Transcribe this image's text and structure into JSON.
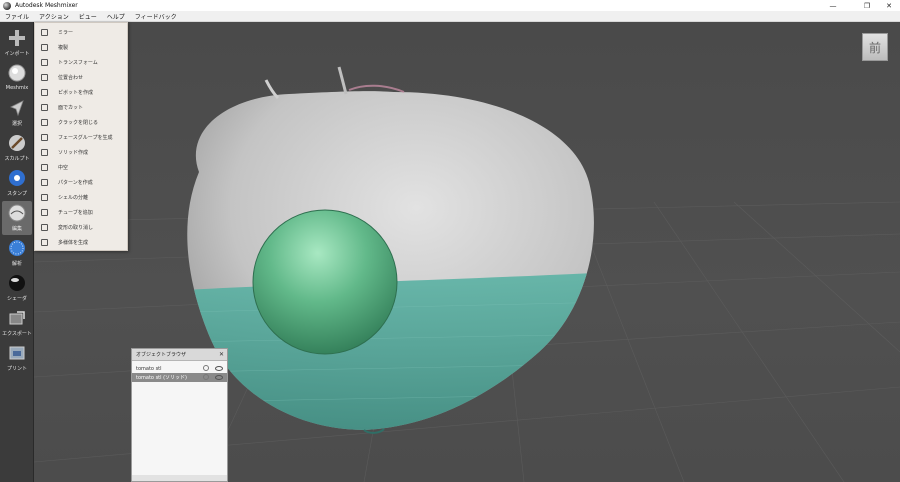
{
  "window": {
    "title": "Autodesk Meshmixer",
    "controls": {
      "minimize": "—",
      "maximize": "❐",
      "close": "✕"
    }
  },
  "menubar": {
    "items": [
      "ファイル",
      "アクション",
      "ビュー",
      "ヘルプ",
      "フィードバック"
    ]
  },
  "toolbar": {
    "items": [
      {
        "label": "インポート",
        "icon": "plus-icon"
      },
      {
        "label": "Meshmix",
        "icon": "meshmix-icon"
      },
      {
        "label": "選択",
        "icon": "select-arrow-icon"
      },
      {
        "label": "スカルプト",
        "icon": "brush-icon"
      },
      {
        "label": "スタンプ",
        "icon": "stamp-icon"
      },
      {
        "label": "編集",
        "icon": "edit-sphere-icon"
      },
      {
        "label": "解析",
        "icon": "analysis-icon"
      },
      {
        "label": "シェーダ",
        "icon": "shader-icon"
      },
      {
        "label": "エクスポート",
        "icon": "export-icon"
      },
      {
        "label": "プリント",
        "icon": "print-icon"
      }
    ]
  },
  "edit_menu": {
    "items": [
      {
        "label": "ミラー",
        "icon": "mirror-icon"
      },
      {
        "label": "複製",
        "icon": "duplicate-icon"
      },
      {
        "label": "トランスフォーム",
        "icon": "transform-icon"
      },
      {
        "label": "位置合わせ",
        "icon": "align-icon"
      },
      {
        "label": "ピボットを作成",
        "icon": "pivot-icon"
      },
      {
        "label": "面でカット",
        "icon": "plane-cut-icon"
      },
      {
        "label": "クラックを閉じる",
        "icon": "close-cracks-icon"
      },
      {
        "label": "フェースグループを生成",
        "icon": "facegroups-icon"
      },
      {
        "label": "ソリッド作成",
        "icon": "make-solid-icon"
      },
      {
        "label": "中空",
        "icon": "hollow-icon"
      },
      {
        "label": "パターンを作成",
        "icon": "pattern-icon"
      },
      {
        "label": "シェルの分離",
        "icon": "separate-shells-icon"
      },
      {
        "label": "チューブを追加",
        "icon": "add-tube-icon"
      },
      {
        "label": "変形の取り消し",
        "icon": "replace-icon"
      },
      {
        "label": "多様体を生成",
        "icon": "manifold-icon"
      }
    ]
  },
  "viewcube": {
    "face_label": "前"
  },
  "object_browser": {
    "title": "オブジェクトブラウザ",
    "close": "✕",
    "objects": [
      {
        "name": "tomato stl",
        "selected": false
      },
      {
        "name": "tomato stl (ソリッド)",
        "selected": true
      }
    ]
  },
  "colors": {
    "viewport_bg": "#4d4d4d",
    "mesh_gray": "#c8c8c8",
    "mesh_teal": "#4fa79a",
    "sphere_green": "#5ab586",
    "active_tool": "#6a6a6a",
    "menu_bg": "#efebe6"
  }
}
